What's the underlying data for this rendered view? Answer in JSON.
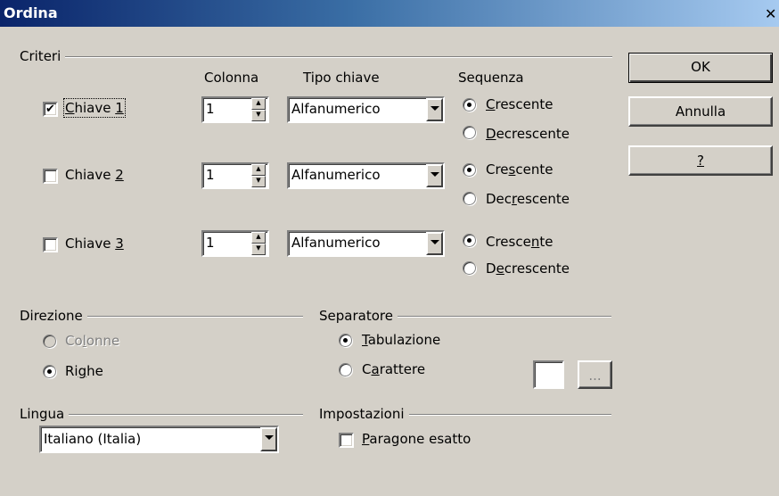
{
  "window": {
    "title": "Ordina",
    "close_icon": "x-close-icon"
  },
  "criteri": {
    "label": "Criteri",
    "col_header_colonna": "Colonna",
    "col_header_tipo": "Tipo chiave",
    "col_header_sequenza": "Sequenza",
    "keys": [
      {
        "label": "Chiave 1",
        "checked": true,
        "colonna": "1",
        "tipo": "Alfanumerico",
        "asc": "Crescente",
        "desc": "Decrescente",
        "selected": "asc"
      },
      {
        "label": "Chiave 2",
        "checked": false,
        "colonna": "1",
        "tipo": "Alfanumerico",
        "asc": "Crescente",
        "desc": "Decrescente",
        "selected": "asc"
      },
      {
        "label": "Chiave 3",
        "checked": false,
        "colonna": "1",
        "tipo": "Alfanumerico",
        "asc": "Crescente",
        "desc": "Decrescente",
        "selected": "asc"
      }
    ]
  },
  "direzione": {
    "label": "Direzione",
    "colonne": "Colonne",
    "righe": "Righe",
    "selected": "righe"
  },
  "separatore": {
    "label": "Separatore",
    "tabulazione": "Tabulazione",
    "carattere": "Carattere",
    "selected": "tabulazione",
    "char_button": "..."
  },
  "lingua": {
    "label": "Lingua",
    "value": "Italiano (Italia)"
  },
  "impostazioni": {
    "label": "Impostazioni",
    "paragone_esatto": "Paragone esatto",
    "checked": false
  },
  "buttons": {
    "ok": "OK",
    "annulla": "Annulla",
    "help": "?"
  }
}
